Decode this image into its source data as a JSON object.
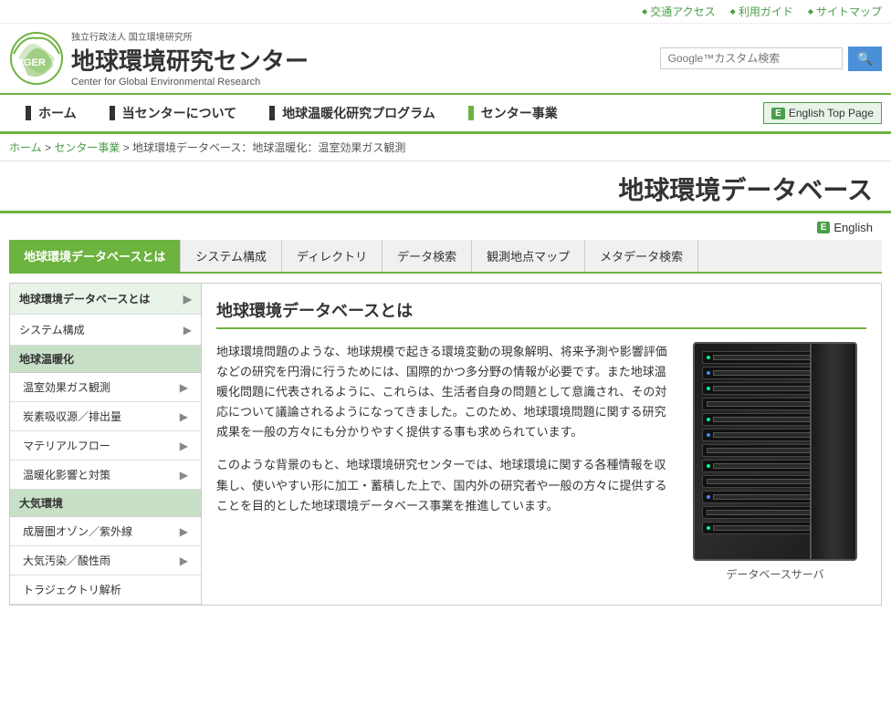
{
  "topbar": {
    "links": [
      {
        "label": "交通アクセス",
        "id": "access"
      },
      {
        "label": "利用ガイド",
        "id": "guide"
      },
      {
        "label": "サイトマップ",
        "id": "sitemap"
      }
    ]
  },
  "header": {
    "org_name": "独立行政法人 国立環境研究所",
    "title": "地球環境研究センター",
    "subtitle": "Center for Global Environmental Research",
    "search_placeholder": "Google™カスタム検索",
    "search_icon": "🔍"
  },
  "main_nav": {
    "items": [
      {
        "label": "ホーム",
        "marker": "dark",
        "id": "home"
      },
      {
        "label": "当センターについて",
        "marker": "dark",
        "id": "about"
      },
      {
        "label": "地球温暖化研究プログラム",
        "marker": "dark",
        "id": "program"
      },
      {
        "label": "センター事業",
        "marker": "green",
        "id": "business"
      }
    ],
    "english_button": "English Top Page"
  },
  "breadcrumb": {
    "items": [
      {
        "label": "ホーム",
        "href": "#"
      },
      {
        "label": "センター事業",
        "href": "#"
      },
      {
        "label": "地球環境データベース：地球温暖化：温室効果ガス観測",
        "href": "#"
      }
    ]
  },
  "page_title": "地球環境データベース",
  "english_badge": "English",
  "tabs": [
    {
      "label": "地球環境データベースとは",
      "active": true,
      "id": "about-db"
    },
    {
      "label": "システム構成",
      "active": false,
      "id": "system"
    },
    {
      "label": "ディレクトリ",
      "active": false,
      "id": "directory"
    },
    {
      "label": "データ検索",
      "active": false,
      "id": "search"
    },
    {
      "label": "観測地点マップ",
      "active": false,
      "id": "map"
    },
    {
      "label": "メタデータ検索",
      "active": false,
      "id": "metadata"
    }
  ],
  "sidebar": {
    "top_item": {
      "label": "地球環境データベースとは",
      "active": true
    },
    "second_item": {
      "label": "システム構成"
    },
    "categories": [
      {
        "label": "地球温暖化",
        "items": [
          {
            "label": "温室効果ガス観測"
          },
          {
            "label": "炭素吸収源／排出量"
          },
          {
            "label": "マテリアルフロー"
          },
          {
            "label": "温暖化影響と対策"
          }
        ]
      },
      {
        "label": "大気環境",
        "items": [
          {
            "label": "成層圏オゾン／紫外線"
          },
          {
            "label": "大気汚染／酸性雨"
          },
          {
            "label": "トラジェクトリ解析"
          }
        ]
      }
    ]
  },
  "main": {
    "section_title": "地球環境データベースとは",
    "paragraphs": [
      "地球環境問題のような、地球規模で起きる環境変動の現象解明、将来予測や影響評価などの研究を円滑に行うためには、国際的かつ多分野の情報が必要です。また地球温暖化問題に代表されるように、これらは、生活者自身の問題として意識され、その対応について議論されるようになってきました。このため、地球環境問題に関する研究成果を一般の方々にも分かりやすく提供する事も求められています。",
      "このような背景のもと、地球環境研究センターでは、地球環境に関する各種情報を収集し、使いやすい形に加工・蓄積した上で、国内外の研究者や一般の方々に提供することを目的とした地球環境データベース事業を推進しています。"
    ],
    "image_caption": "データベースサーバ"
  }
}
